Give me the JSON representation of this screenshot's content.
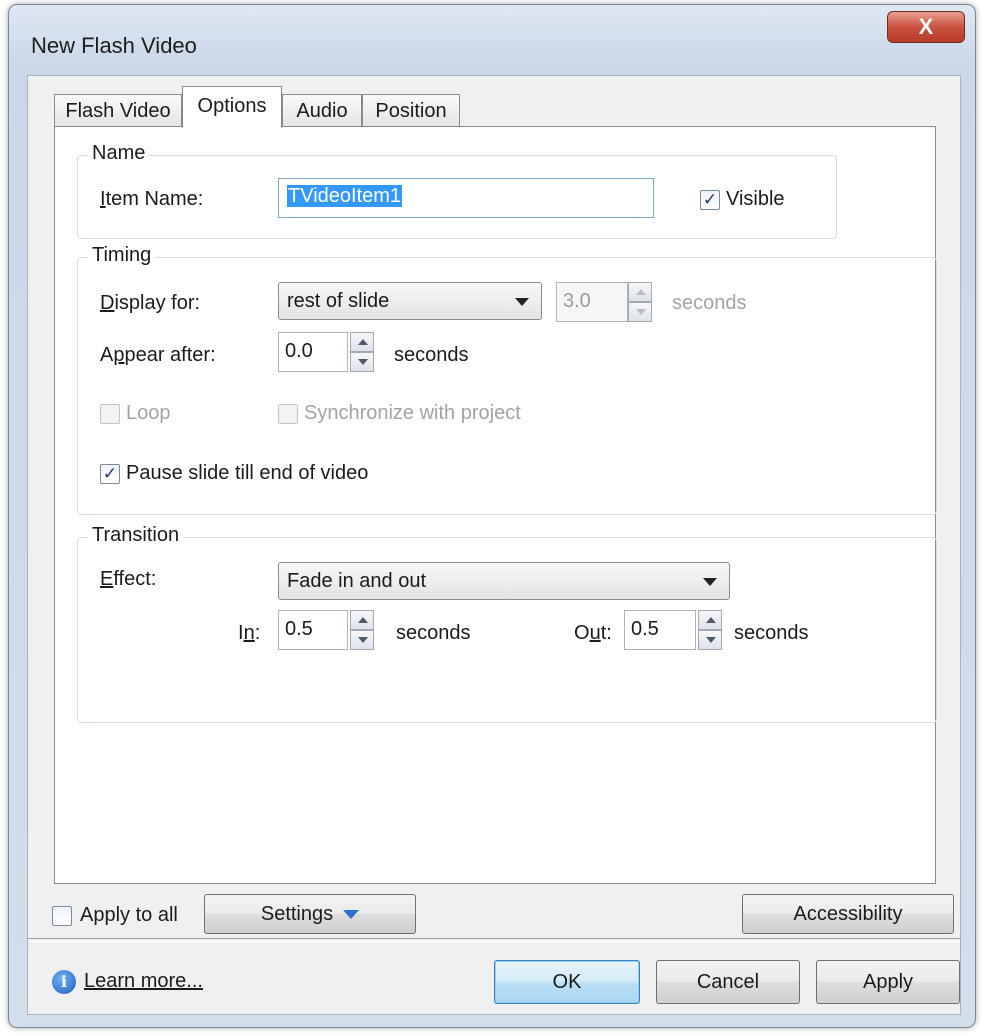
{
  "window": {
    "title": "New Flash Video",
    "close_label": "X"
  },
  "tabs": [
    {
      "label": "Flash Video"
    },
    {
      "label": "Options"
    },
    {
      "label": "Audio"
    },
    {
      "label": "Position"
    }
  ],
  "name_group": {
    "title": "Name",
    "item_name_label": "Item Name:",
    "item_name_value": "TVideoItem1",
    "visible_label": "Visible",
    "visible_checked": true
  },
  "timing_group": {
    "title": "Timing",
    "display_for_label": "Display for:",
    "display_for_value": "rest of slide",
    "display_seconds_value": "3.0",
    "display_seconds_unit": "seconds",
    "appear_after_label": "Appear after:",
    "appear_after_value": "0.0",
    "appear_after_unit": "seconds",
    "loop_label": "Loop",
    "sync_label": "Synchronize with project",
    "pause_label": "Pause slide till end of video",
    "pause_checked": true
  },
  "transition_group": {
    "title": "Transition",
    "effect_label": "Effect:",
    "effect_value": "Fade in and out",
    "in_label": "In:",
    "in_value": "0.5",
    "in_unit": "seconds",
    "out_label": "Out:",
    "out_value": "0.5",
    "out_unit": "seconds"
  },
  "bottom": {
    "apply_to_all_label": "Apply to all",
    "settings_label": "Settings",
    "accessibility_label": "Accessibility",
    "learn_more_label": "Learn more...",
    "ok_label": "OK",
    "cancel_label": "Cancel",
    "apply_label": "Apply"
  },
  "icons": {
    "check_glyph": "✓",
    "info_glyph": "i"
  }
}
